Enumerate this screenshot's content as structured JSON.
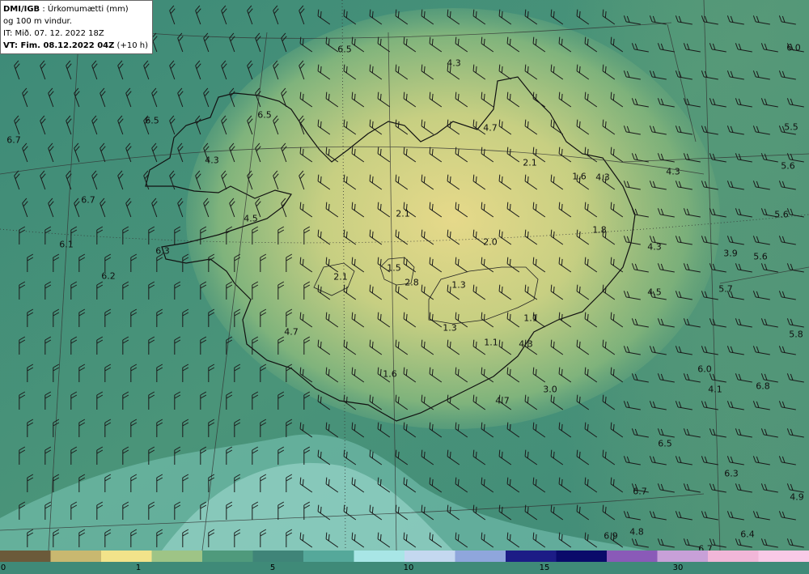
{
  "header": {
    "source": "DMI/IGB",
    "title_rest": " : Úrkomumætti (mm)",
    "line2": "og 100 m vindur.",
    "line3": "IT: Mið. 07. 12. 2022 18Z",
    "vt_bold": "VT: Fim. 08.12.2022 04Z",
    "vt_rest": " (+10 h)"
  },
  "map_labels": [
    "6.5",
    "4.3",
    "6.0",
    "6.7",
    "6.5",
    "6.5",
    "4.7",
    "5.5",
    "4.3",
    "2.1",
    "1.6",
    "4.3",
    "4.3",
    "5.6",
    "6.7",
    "4.5",
    "2.1",
    "5.6",
    "6.1",
    "1.8",
    "6.3",
    "2.0",
    "4.3",
    "3.9",
    "5.6",
    "1.5",
    "6.2",
    "2.1",
    "2.8",
    "1.3",
    "5.7",
    "4.5",
    "4.7",
    "1.1",
    "5.8",
    "1.3",
    "1.1",
    "4.3",
    "6.0",
    "1.6",
    "4.1",
    "6.8",
    "3.0",
    "4.7",
    "6.5",
    "6.3",
    "6.7",
    "4.9",
    "6.9",
    "4.8",
    "6.4",
    "6.7"
  ],
  "colorbar": {
    "ticks": [
      "0",
      "1",
      "5",
      "10",
      "15",
      "30"
    ],
    "colors": [
      "#6b5a3a",
      "#c9b870",
      "#f2e38a",
      "#9ec486",
      "#4f9a7c",
      "#3f8478",
      "#55a89a",
      "#a8e6e6",
      "#c4d8f0",
      "#8fa6dc",
      "#1c1c86",
      "#0a0a6a",
      "#8a5ab8",
      "#c8a0d8",
      "#f2b6d8",
      "#f9c8e6"
    ]
  }
}
